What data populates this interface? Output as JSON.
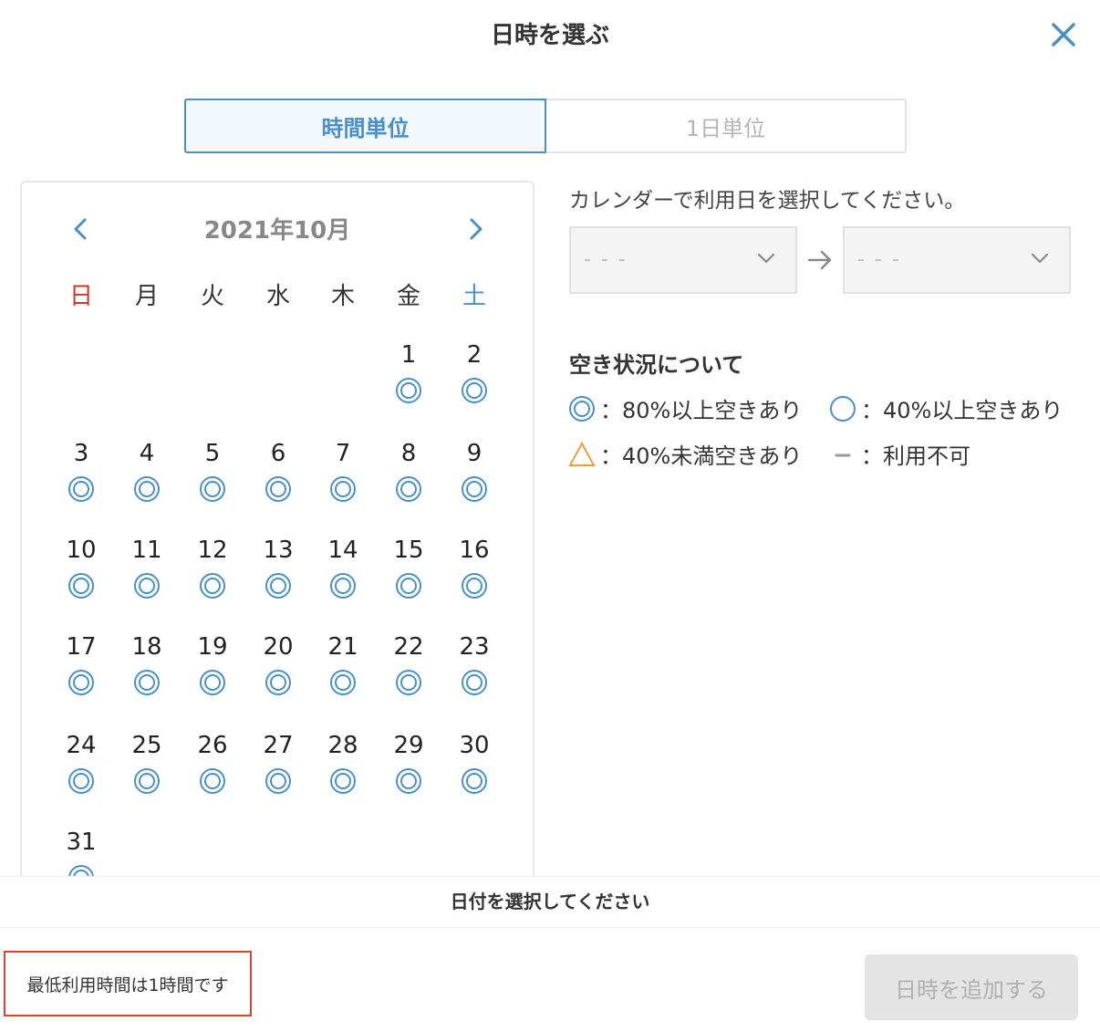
{
  "modal": {
    "title": "日時を選ぶ",
    "close_icon": "close-icon"
  },
  "tabs": [
    {
      "label": "時間単位",
      "active": true
    },
    {
      "label": "1日単位",
      "active": false
    }
  ],
  "calendar": {
    "month_label": "2021年10月",
    "weekdays": [
      "日",
      "月",
      "火",
      "水",
      "木",
      "金",
      "土"
    ],
    "weekday_colors": {
      "sunday": "#d0342c",
      "saturday": "#4a90c8",
      "default": "#333333"
    },
    "days": [
      "1",
      "2",
      "3",
      "4",
      "5",
      "6",
      "7",
      "8",
      "9",
      "10",
      "11",
      "12",
      "13",
      "14",
      "15",
      "16",
      "17",
      "18",
      "19",
      "20",
      "21",
      "22",
      "23",
      "24",
      "25",
      "26",
      "27",
      "28",
      "29",
      "30",
      "31"
    ],
    "availability": "double-circle",
    "mark_color": "#4a90c8"
  },
  "selection": {
    "instruction": "カレンダーで利用日を選択してください。",
    "start_value": "- - -",
    "end_value": "- - -"
  },
  "legend": {
    "title": "空き状況について",
    "items": [
      {
        "icon": "double-circle-icon",
        "label": "：80%以上空きあり"
      },
      {
        "icon": "circle-icon",
        "label": "：40%以上空きあり"
      },
      {
        "icon": "triangle-icon",
        "label": "：40%未満空きあり"
      },
      {
        "icon": "dash-icon",
        "label": "：利用不可"
      }
    ],
    "triangle_color": "#e8a13a",
    "dash_color": "#999999"
  },
  "footer": {
    "message": "日付を選択してください",
    "note": "最低利用時間は1時間です",
    "add_button": "日時を追加する"
  }
}
